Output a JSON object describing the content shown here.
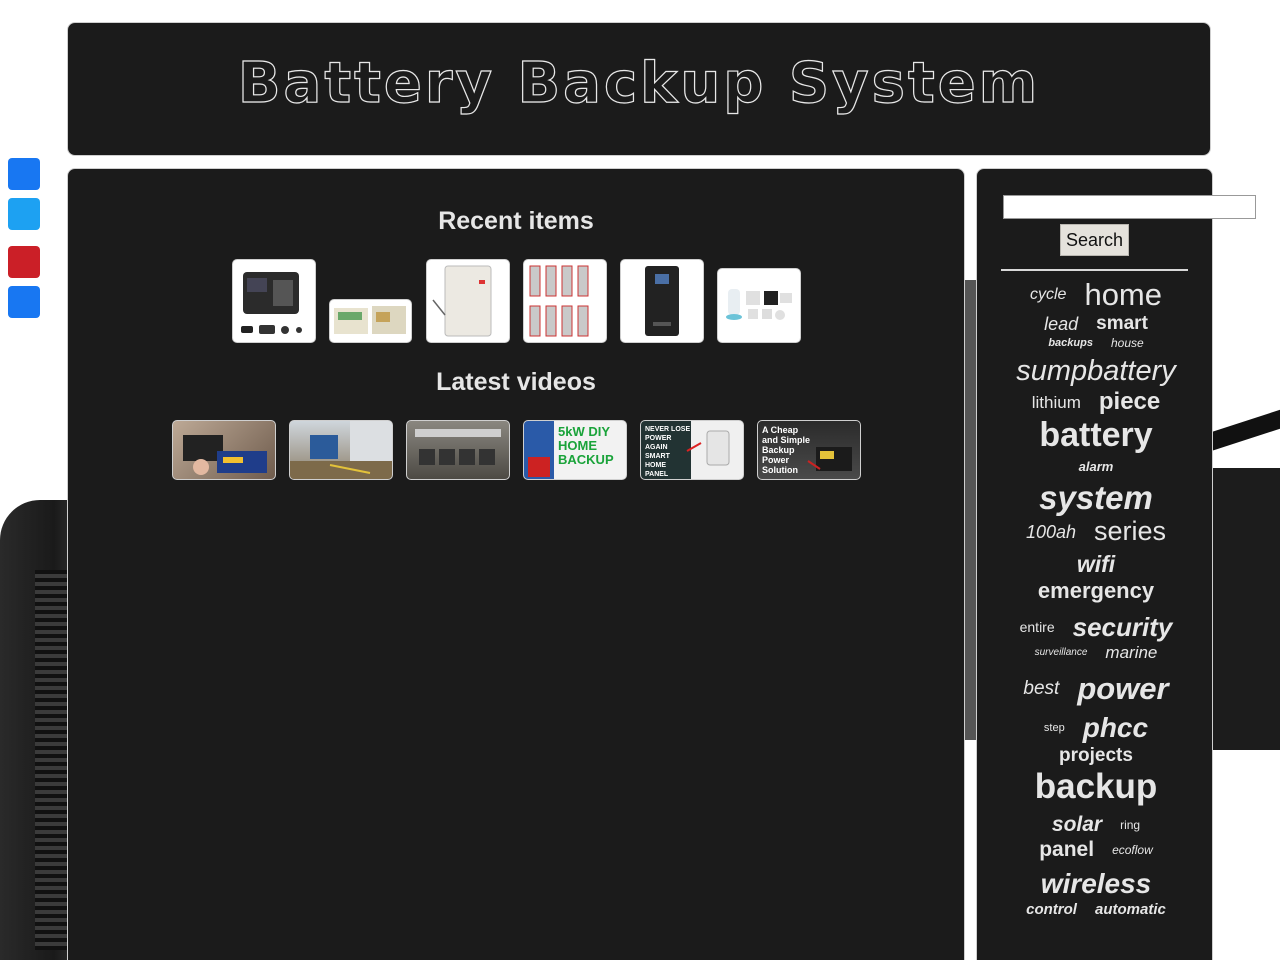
{
  "site": {
    "title": "Battery Backup System"
  },
  "share": {
    "buttons": [
      {
        "name": "facebook",
        "color": "#1877f2"
      },
      {
        "name": "twitter",
        "color": "#1da1f2"
      },
      {
        "name": "pinterest",
        "color": "#cb1f27"
      },
      {
        "name": "share",
        "color": "#1877f2"
      }
    ]
  },
  "main": {
    "recent_title": "Recent items",
    "videos_title": "Latest videos",
    "video_captions": [
      "",
      "",
      "",
      "5kW DIY HOME BACKUP",
      "NEVER LOSE POWER AGAIN SMART HOME PANEL",
      "A Cheap and Simple Backup Power Solution"
    ]
  },
  "sidebar": {
    "search_placeholder": "",
    "search_button": "Search",
    "tags": [
      "cycle",
      "home",
      "lead",
      "smart",
      "backups",
      "house",
      "sumpbattery",
      "lithium",
      "piece",
      "battery",
      "alarm",
      "system",
      "100ah",
      "series",
      "wifi",
      "emergency",
      "entire",
      "security",
      "surveillance",
      "marine",
      "best",
      "power",
      "step",
      "phcc",
      "projects",
      "backup",
      "solar",
      "ring",
      "panel",
      "ecoflow",
      "wireless",
      "control",
      "automatic"
    ]
  }
}
